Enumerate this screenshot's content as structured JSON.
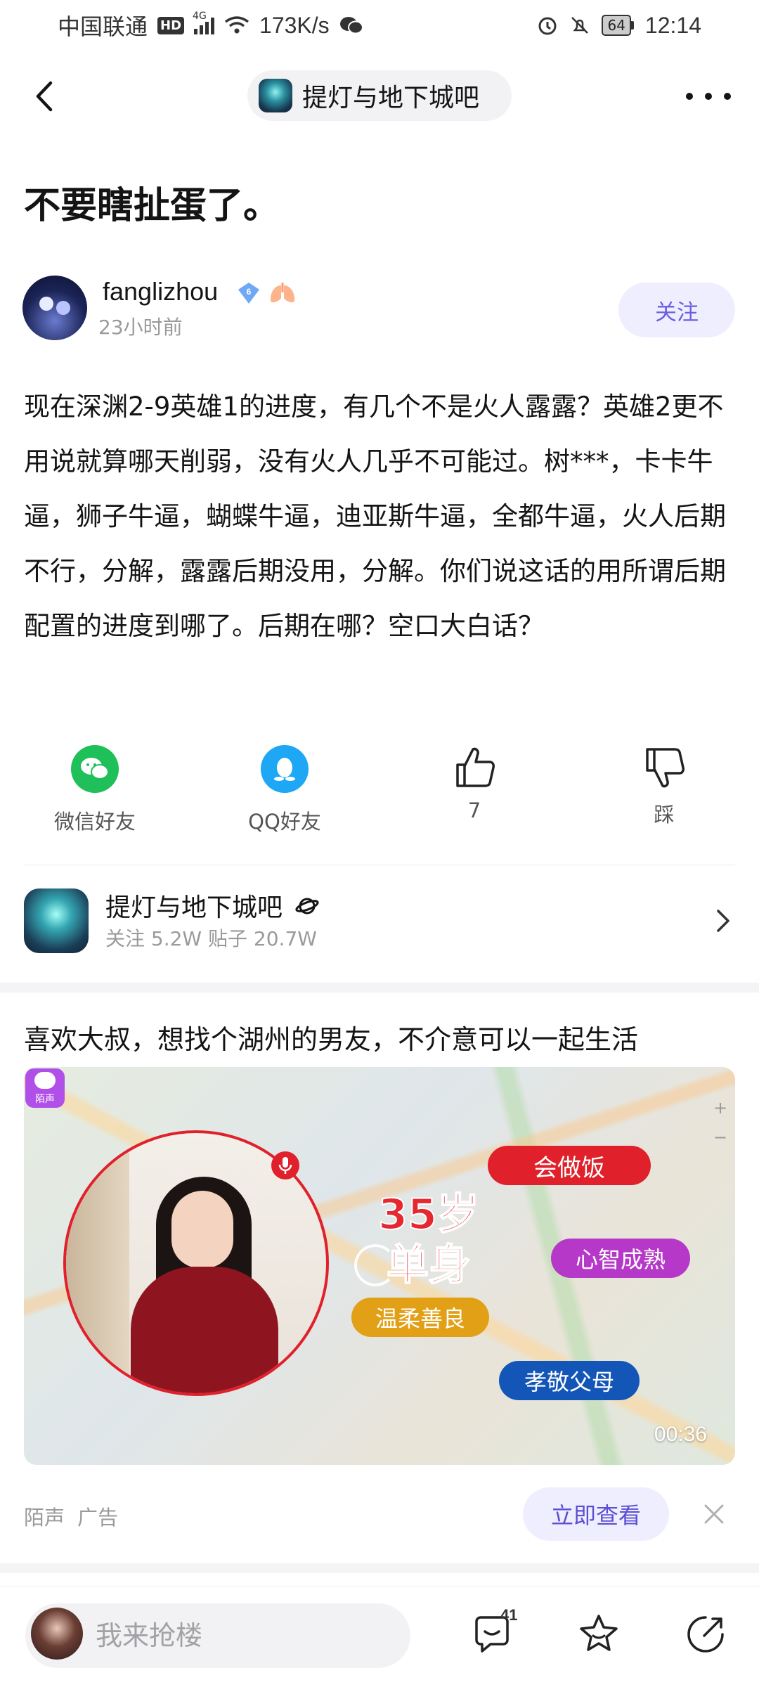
{
  "status_bar": {
    "carrier": "中国联通",
    "hd": "HD",
    "network": "4G",
    "speed": "173K/s",
    "battery": "64",
    "time": "12:14"
  },
  "nav": {
    "forum_name": "提灯与地下城吧"
  },
  "post": {
    "title": "不要瞎扯蛋了。",
    "author": "fanglizhou",
    "time_ago": "23小时前",
    "follow_label": "关注",
    "body": "现在深渊2-9英雄1的进度，有几个不是火人露露？英雄2更不用说就算哪天削弱，没有火人几乎不可能过。树***，卡卡牛逼，狮子牛逼，蝴蝶牛逼，迪亚斯牛逼，全都牛逼，火人后期不行，分解，露露后期没用，分解。你们说这话的用所谓后期配置的进度到哪了。后期在哪？空口大白话？"
  },
  "actions": {
    "wechat": "微信好友",
    "qq": "QQ好友",
    "like_count": "7",
    "dislike": "踩"
  },
  "forum_card": {
    "name": "提灯与地下城吧",
    "stats": "关注 5.2W   贴子 20.7W"
  },
  "ad": {
    "title": "喜欢大叔，想找个湖州的男友，不介意可以一起生活",
    "app_logo_text": "陌声",
    "headline_line1": "35岁",
    "headline_line2": "单身",
    "tag1": "会做饭",
    "tag2": "心智成熟",
    "tag3": "温柔善良",
    "tag4": "孝敬父母",
    "duration": "00:36",
    "source": "陌声",
    "ad_label": "广告",
    "cta": "立即查看"
  },
  "bottom_bar": {
    "reply_placeholder": "我来抢楼",
    "comment_count": "41"
  },
  "colors": {
    "accent": "#6d5ee0",
    "wechat_green": "#1fbf5a",
    "qq_blue": "#1ea7f5",
    "ad_red": "#e0202a"
  }
}
